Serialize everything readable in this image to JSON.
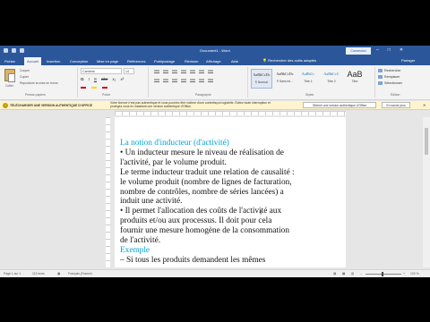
{
  "titlebar": {
    "title": "Document1 - Word",
    "connect_label": "Connexion",
    "minimize": "–",
    "maximize": "□",
    "close": "✕"
  },
  "tabs": [
    {
      "label": "Fichier"
    },
    {
      "label": "Accueil"
    },
    {
      "label": "Insertion"
    },
    {
      "label": "Conception"
    },
    {
      "label": "Mise en page"
    },
    {
      "label": "Références"
    },
    {
      "label": "Publipostage"
    },
    {
      "label": "Révision"
    },
    {
      "label": "Affichage"
    },
    {
      "label": "Aide"
    }
  ],
  "tell_me": "Rechercher des outils adaptés",
  "share": "Partager",
  "ribbon": {
    "paste": "Coller",
    "clipboard_items": [
      "Couper",
      "Copier",
      "Reproduire la mise en forme"
    ],
    "group_clipboard": "Presse-papiers",
    "font_name": "Cambria",
    "font_size": "14",
    "format_buttons": [
      "G",
      "I",
      "S",
      "abc",
      "x₂",
      "x²"
    ],
    "group_font": "Police",
    "group_paragraph": "Paragraphe",
    "styles": [
      {
        "sample": "AaBbCcDc",
        "name": "¶ Normal"
      },
      {
        "sample": "AaBbCcDc",
        "name": "¶ Sans int..."
      },
      {
        "sample": "AaBbCc",
        "name": "Titre 1"
      },
      {
        "sample": "AaBbCcC",
        "name": "Titre 2"
      },
      {
        "sample": "AaB",
        "name": "Titre"
      }
    ],
    "group_styles": "Styles",
    "editing": [
      "Rechercher",
      "Remplacer",
      "Sélectionner"
    ],
    "group_editing": "Édition"
  },
  "notification": {
    "title": "TÉLÉCHARGER UNE VERSION AUTHENTIQUE D'OFFICE",
    "message": "Votre licence n'est pas authentique et vous pourriez être victime d'une contrefaçon logicielle. Évitez toute interruption et protégez-vous en installant une version authentique d'Office.",
    "primary_button": "Obtenir une version authentique d'Office",
    "secondary_button": "En savoir plus"
  },
  "document": {
    "heading": "La notion d'inducteur (d'activité)",
    "lines": [
      "• Un inducteur mesure le niveau de réalisation de",
      "l'activité, par le volume produit.",
      "Le terme inducteur traduit une relation de causalité :",
      "le volume produit (nombre de lignes de facturation,",
      "nombre de contrôles, nombre de séries lancées) a",
      "induit une activité.",
      "• Il permet l'allocation des coûts de l'activité aux",
      "produits et/ou aux processus. Il doit pour cela",
      "fournir une mesure homogène de la consommation",
      "de l'activité."
    ],
    "subheading": "Exemple",
    "last_line": "– Si tous les produits demandent les mêmes"
  },
  "status": {
    "page": "Page 1 sur 1",
    "words": "113 mots",
    "language": "Français (France)",
    "zoom": "120 %"
  }
}
